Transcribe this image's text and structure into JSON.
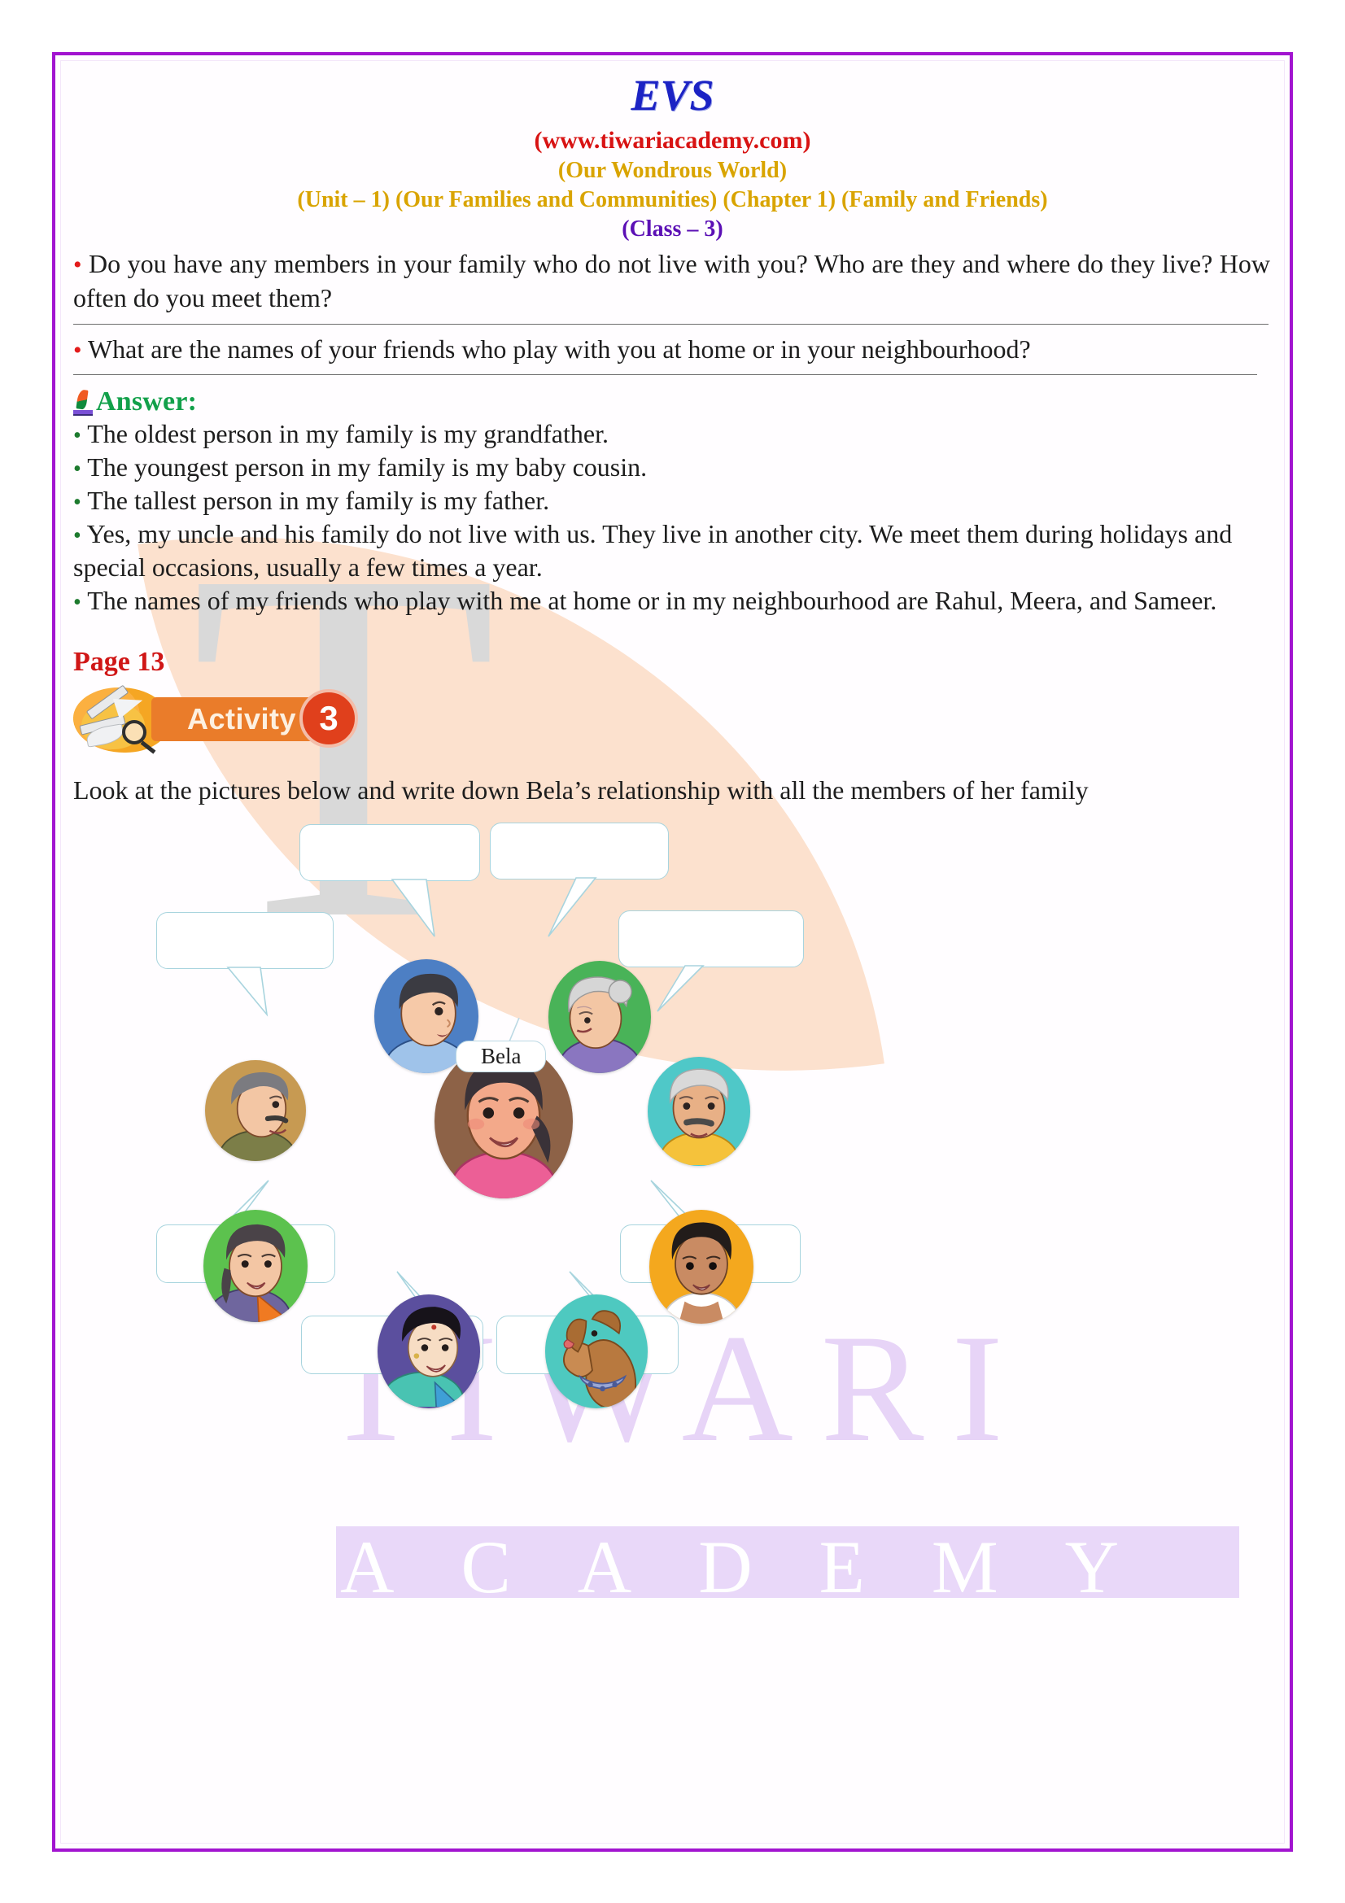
{
  "document": {
    "title": "EVS",
    "website": "(www.tiwariacademy.com)",
    "book_title": "(Our Wondrous World)",
    "unit_chapter": "(Unit – 1) (Our Families and Communities) (Chapter 1) (Family and Friends)",
    "class": "(Class – 3)"
  },
  "colors": {
    "border": "#a214d0",
    "title": "#1c23c4",
    "website": "#d81313",
    "subtitle": "#d9a400",
    "class": "#5b0fb5",
    "answer_label": "#12a04a",
    "page_label": "#d01616",
    "question_bullet": "#e31b1b",
    "answer_bullet": "#1d7a2e",
    "activity_bar": "#ea7c2a",
    "activity_badge": "#e0401c",
    "bubble_border": "#a8d4de"
  },
  "questions": [
    "Do you have any members in your family who do not live with you? Who are they and where do they live? How often do you meet them?",
    "What are the names of your friends who play with you at home or in your neighbourhood?"
  ],
  "answer": {
    "label": "Answer:",
    "icon": "quill-pen-icon",
    "items": [
      "The oldest person in my family is my grandfather.",
      "The youngest person in my family is my baby cousin.",
      "The tallest person in my family is my father.",
      "Yes, my uncle and his family do not live with us. They live in another city. We meet them during holidays and special occasions, usually a few times a year.",
      "The names of my friends who play with me at home or in my neighbourhood are Rahul, Meera, and Sameer."
    ]
  },
  "page_marker": "Page 13",
  "activity": {
    "label": "Activity",
    "number": "3",
    "instruction": "Look at the pictures below and write down Bela’s relationship with all the members of her family"
  },
  "diagram": {
    "center_label": "Bela",
    "blank_bubbles": 8,
    "portraits": [
      {
        "name": "boy-brother-portrait",
        "bg": "#4d7fc4"
      },
      {
        "name": "grandmother-portrait",
        "bg": "#49b358"
      },
      {
        "name": "grandfather-left-portrait",
        "bg": "#c79a52"
      },
      {
        "name": "bela-center-portrait",
        "bg": "#8d6247"
      },
      {
        "name": "grandfather-right-portrait",
        "bg": "#4fc8c8"
      },
      {
        "name": "mother-green-portrait",
        "bg": "#5cc24e"
      },
      {
        "name": "young-boy-portrait",
        "bg": "#f4a81e"
      },
      {
        "name": "aunt-purple-portrait",
        "bg": "#5b4f9e"
      },
      {
        "name": "dog-portrait",
        "bg": "#4ec9c0"
      }
    ]
  },
  "watermark": {
    "brand_top": "TIWARI",
    "brand_bottom": "ACADEMY",
    "letter": "T"
  }
}
